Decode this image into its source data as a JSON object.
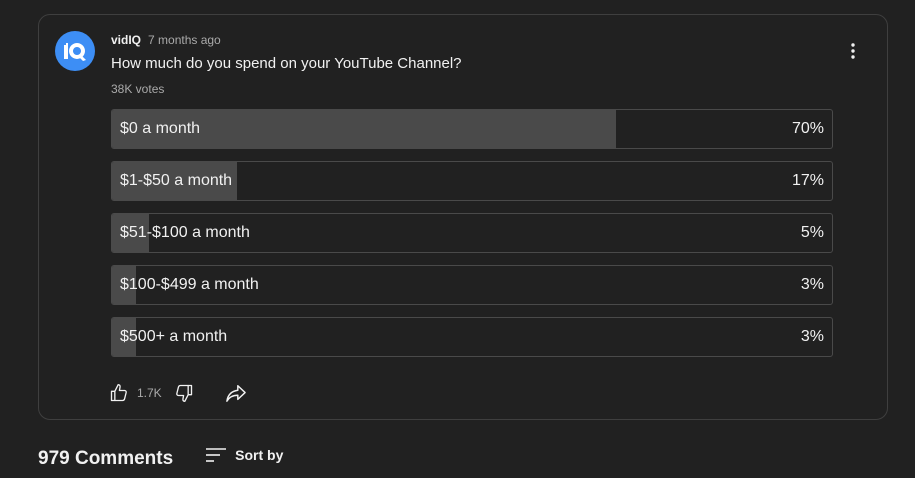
{
  "post": {
    "author": "vidIQ",
    "timestamp": "7 months ago",
    "question": "How much do you spend on your YouTube Channel?",
    "votes": "38K votes",
    "avatar_color": "#3d8ef5",
    "avatar_icon": "vidiq-logo-icon",
    "menu_icon": "more-vertical-icon"
  },
  "poll": {
    "options": [
      {
        "label": "$0 a month",
        "percent_text": "70%",
        "fill_fraction": 0.7
      },
      {
        "label": "$1-$50 a month",
        "percent_text": "17%",
        "fill_fraction": 0.174
      },
      {
        "label": "$51-$100 a month",
        "percent_text": "5%",
        "fill_fraction": 0.052
      },
      {
        "label": "$100-$499 a month",
        "percent_text": "3%",
        "fill_fraction": 0.034
      },
      {
        "label": "$500+ a month",
        "percent_text": "3%",
        "fill_fraction": 0.034
      }
    ]
  },
  "actions": {
    "like_count": "1.7K",
    "like_icon": "thumbs-up-icon",
    "dislike_icon": "thumbs-down-icon",
    "share_icon": "share-icon"
  },
  "comments": {
    "count_label": "979 Comments",
    "sort_label": "Sort by",
    "sort_icon": "sort-icon"
  }
}
